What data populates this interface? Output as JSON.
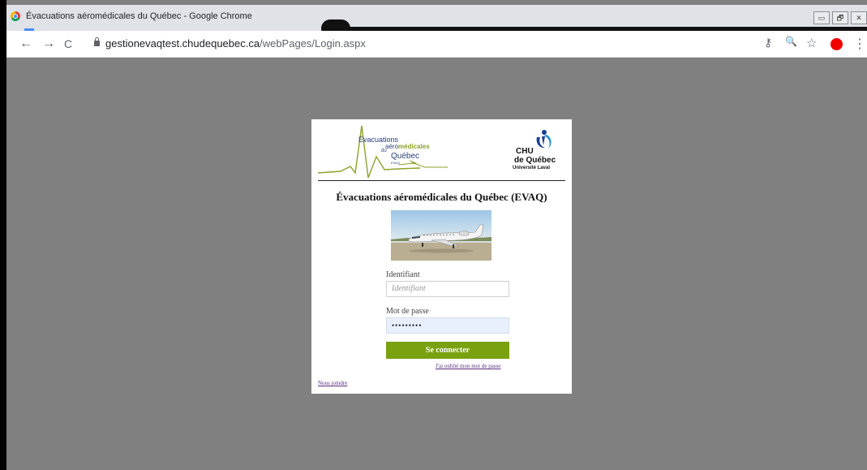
{
  "browser": {
    "window_title": "Évacuations aéromédicales du Québec - Google Chrome",
    "url_host": "gestionevaqtest.chudequebec.ca",
    "url_path": "/webPages/Login.aspx",
    "window_controls": {
      "minimize": "▭",
      "restore": "🗗",
      "close": "✕"
    },
    "nav_icons": {
      "back": "←",
      "forward": "→",
      "reload": "C"
    },
    "toolbar_icons": {
      "key": "⚷",
      "zoom": "🔍",
      "star": "☆",
      "menu": "⋮"
    },
    "record_color": "#f20000"
  },
  "page": {
    "logo_left": {
      "line1": "Évacuations",
      "line2_prefix": "aéro",
      "line2_bold": "médicales",
      "line3": "du",
      "line4": "Québec",
      "line5": "EVAQ"
    },
    "logo_right": {
      "line1": "CHU",
      "line2": "de Québec",
      "line3": "Université Laval"
    },
    "heading": "Évacuations aéromédicales du Québec (EVAQ)",
    "username_label": "Identifiant",
    "username_placeholder": "Identifiant",
    "password_label": "Mot de passe",
    "password_value": "•••••••••",
    "login_button": "Se connecter",
    "forgot_link": "J'ai oublié mon mot de passe",
    "contact_link": "Nous joindre",
    "accent_color": "#7aa10f"
  }
}
